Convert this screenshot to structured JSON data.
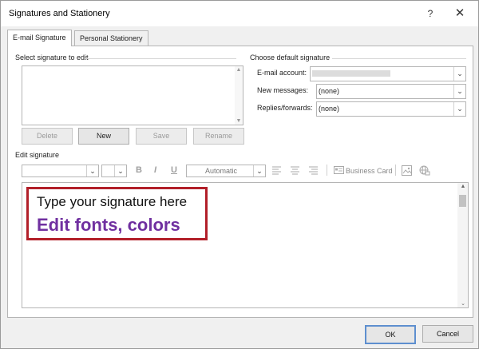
{
  "window": {
    "title": "Signatures and Stationery",
    "help_label": "?",
    "close_label": "✕"
  },
  "tabs": [
    {
      "label": "E-mail Signature",
      "active": true
    },
    {
      "label": "Personal Stationery",
      "active": false
    }
  ],
  "select_signature": {
    "label": "Select signature to edit",
    "buttons": {
      "delete": "Delete",
      "new": "New",
      "save": "Save",
      "rename": "Rename"
    }
  },
  "default_signature": {
    "label": "Choose default signature",
    "email_account_label": "E-mail account:",
    "email_account_value": "",
    "new_messages_label": "New messages:",
    "new_messages_value": "(none)",
    "replies_label": "Replies/forwards:",
    "replies_value": "(none)"
  },
  "edit_signature": {
    "label": "Edit signature",
    "toolbar": {
      "bold": "B",
      "italic": "I",
      "underline": "U",
      "color_label": "Automatic",
      "business_card_label": "Business Card"
    },
    "content": {
      "line1": "Type your signature here",
      "line2": "Edit fonts, colors"
    },
    "colors": {
      "highlight_border": "#b21f29",
      "line2_color": "#7030a0"
    }
  },
  "footer": {
    "ok": "OK",
    "cancel": "Cancel"
  }
}
